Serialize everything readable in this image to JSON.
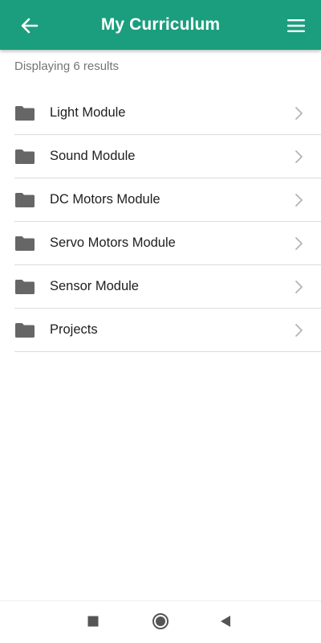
{
  "header": {
    "title": "My Curriculum",
    "back_icon": "arrow-left-icon",
    "menu_icon": "hamburger-menu-icon",
    "background_color": "#1b9e7e"
  },
  "results": {
    "count_text": "Displaying 6 results"
  },
  "modules": [
    {
      "label": "Light Module",
      "icon": "folder-icon"
    },
    {
      "label": "Sound Module",
      "icon": "folder-icon"
    },
    {
      "label": "DC Motors Module",
      "icon": "folder-icon"
    },
    {
      "label": "Servo Motors Module",
      "icon": "folder-icon"
    },
    {
      "label": "Sensor Module",
      "icon": "folder-icon"
    },
    {
      "label": "Projects",
      "icon": "folder-icon"
    }
  ],
  "system_nav": {
    "recents_icon": "square-icon",
    "home_icon": "circle-icon",
    "back_icon": "triangle-back-icon"
  }
}
